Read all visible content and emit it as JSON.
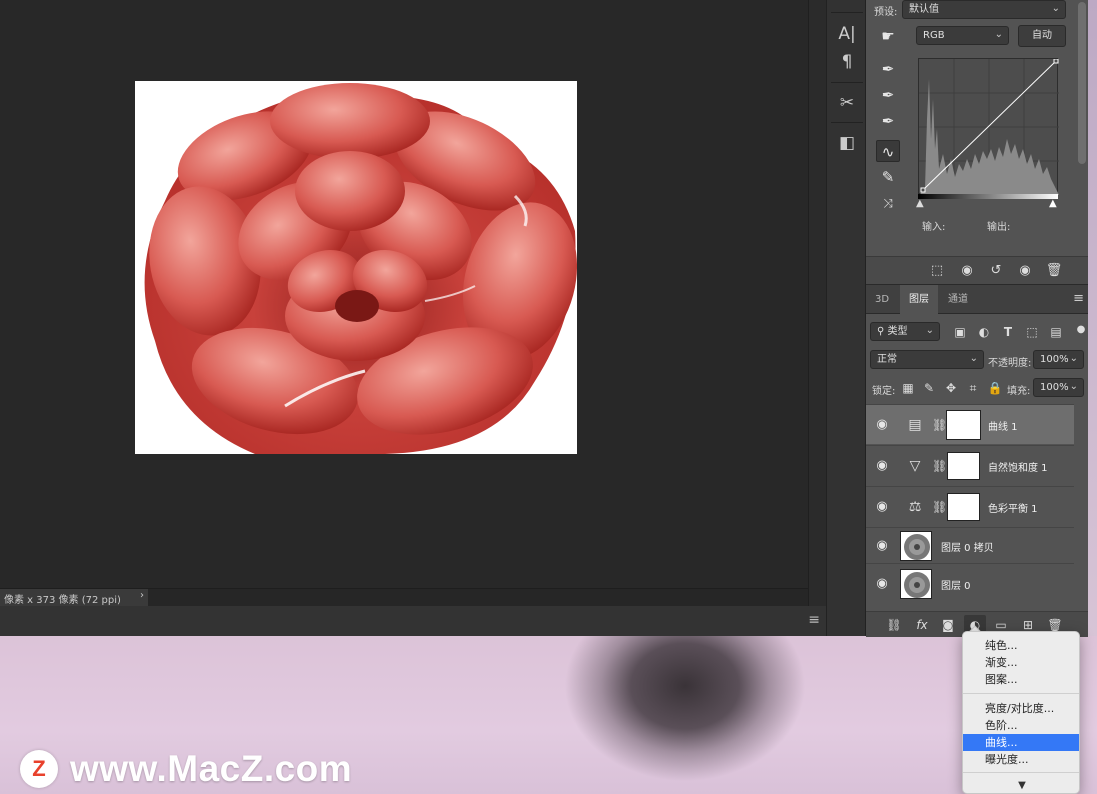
{
  "desktop": {
    "watermark_logo": "Z",
    "watermark_text": "www.MacZ.com"
  },
  "status_bar": {
    "doc_info": "像素 x 373 像素 (72 ppi)",
    "arrow": "›"
  },
  "properties_panel": {
    "preset_label": "预设:",
    "preset_value": "默认值",
    "channel_value": "RGB",
    "auto_button": "自动",
    "input_label": "输入:",
    "output_label": "输出:"
  },
  "layers_panel": {
    "tabs": [
      {
        "label": "3D"
      },
      {
        "label": "图层"
      },
      {
        "label": "通道"
      }
    ],
    "filter_kind": "类型",
    "blend_mode": "正常",
    "opacity_label": "不透明度:",
    "opacity_value": "100%",
    "lock_label": "锁定:",
    "fill_label": "填充:",
    "fill_value": "100%",
    "layers": [
      {
        "name": "曲线 1",
        "type": "curves",
        "visible": true,
        "selected": true
      },
      {
        "name": "自然饱和度 1",
        "type": "vibrance",
        "visible": true,
        "selected": false
      },
      {
        "name": "色彩平衡 1",
        "type": "color-balance",
        "visible": true,
        "selected": false
      },
      {
        "name": "图层 0 拷贝",
        "type": "pixel",
        "visible": true,
        "selected": false
      },
      {
        "name": "图层 0",
        "type": "pixel",
        "visible": true,
        "selected": false
      }
    ]
  },
  "adjustment_menu": {
    "items": [
      {
        "label": "纯色...",
        "highlighted": false
      },
      {
        "label": "渐变...",
        "highlighted": false
      },
      {
        "label": "图案...",
        "highlighted": false
      },
      {
        "label": "亮度/对比度...",
        "highlighted": false
      },
      {
        "label": "色阶...",
        "highlighted": false
      },
      {
        "label": "曲线...",
        "highlighted": true
      },
      {
        "label": "曝光度...",
        "highlighted": false
      }
    ],
    "more_arrow": "▼"
  },
  "colors": {
    "highlight": "#3478f6",
    "panel_bg": "#535353",
    "canvas_bg": "#282828",
    "rose_red": "#d0473f"
  }
}
